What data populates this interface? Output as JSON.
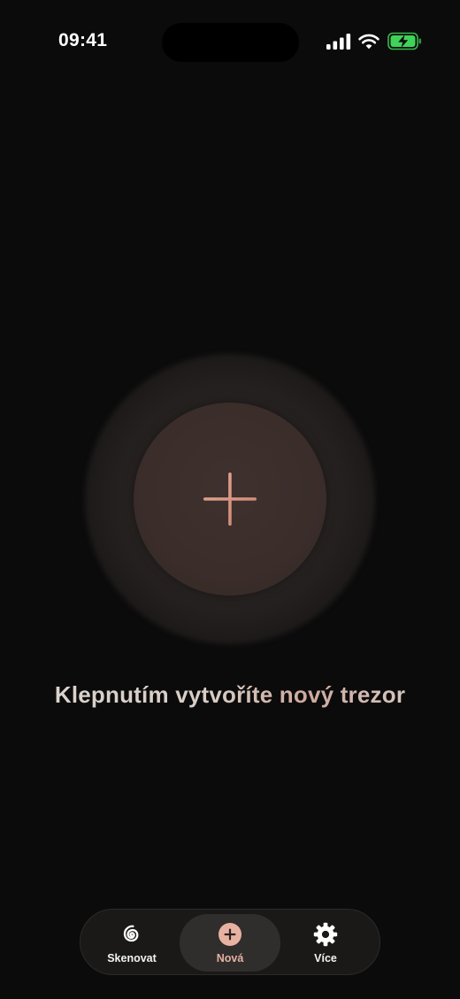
{
  "status_bar": {
    "time": "09:41"
  },
  "main": {
    "create_button_icon": "plus-icon",
    "hint": "Klepnutím vytvoříte nový trezor"
  },
  "tab_bar": {
    "items": [
      {
        "label": "Skenovat",
        "icon": "spiral-scan-icon",
        "active": false
      },
      {
        "label": "Nová",
        "icon": "plus-circle-icon",
        "active": true
      },
      {
        "label": "Více",
        "icon": "gear-icon",
        "active": false
      }
    ]
  },
  "colors": {
    "background": "#0c0b0b",
    "accent": "#e6b0a1",
    "button_fill": "#3a2d2a",
    "battery_green": "#3fd35a"
  }
}
